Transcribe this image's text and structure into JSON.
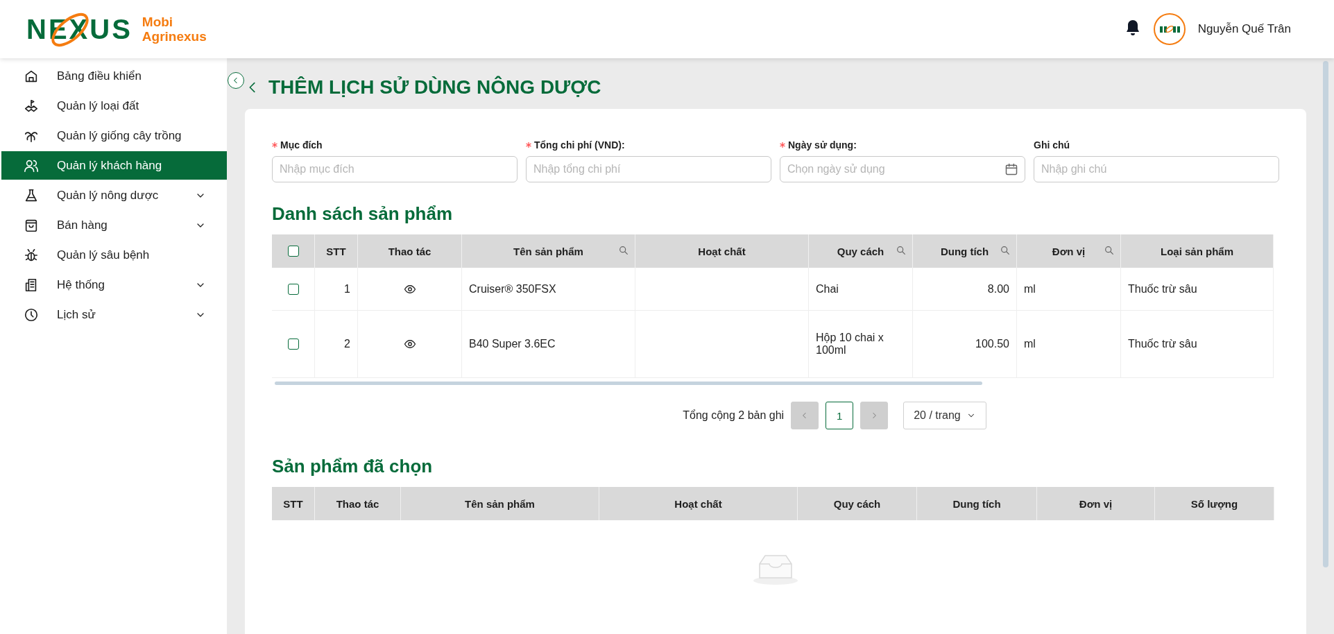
{
  "logo": {
    "wordmark": "NEXUS",
    "brand_line1": "Mobi",
    "brand_line2": "Agrinexus"
  },
  "user": {
    "name": "Nguyễn Quế Trân"
  },
  "sidebar": {
    "items": [
      {
        "label": "Bảng điều khiển",
        "selected": false,
        "has_submenu": false
      },
      {
        "label": "Quản lý loại đất",
        "selected": false,
        "has_submenu": false
      },
      {
        "label": "Quản lý giống cây trồng",
        "selected": false,
        "has_submenu": false
      },
      {
        "label": "Quản lý khách hàng",
        "selected": true,
        "has_submenu": false
      },
      {
        "label": "Quản lý nông dược",
        "selected": false,
        "has_submenu": true
      },
      {
        "label": "Bán hàng",
        "selected": false,
        "has_submenu": true
      },
      {
        "label": "Quản lý sâu bệnh",
        "selected": false,
        "has_submenu": false
      },
      {
        "label": "Hệ thống",
        "selected": false,
        "has_submenu": true
      },
      {
        "label": "Lịch sử",
        "selected": false,
        "has_submenu": true
      }
    ]
  },
  "page_title": "THÊM LỊCH SỬ DÙNG NÔNG DƯỢC",
  "form": {
    "fields": [
      {
        "label": "Mục đích",
        "required": true,
        "placeholder": "Nhập mục đích",
        "kind": "text"
      },
      {
        "label": "Tổng chi phí (VND):",
        "required": true,
        "placeholder": "Nhập tổng chi phí",
        "kind": "text"
      },
      {
        "label": "Ngày sử dụng:",
        "required": true,
        "placeholder": "Chọn ngày sử dụng",
        "kind": "date"
      },
      {
        "label": "Ghi chú",
        "required": false,
        "placeholder": "Nhập ghi chú",
        "kind": "text"
      }
    ]
  },
  "product_list": {
    "title": "Danh sách sản phẩm",
    "select_all": {
      "checked": false
    },
    "columns": [
      {
        "label": "STT",
        "searchable": false
      },
      {
        "label": "Thao tác",
        "searchable": false
      },
      {
        "label": "Tên sản phẩm",
        "searchable": true
      },
      {
        "label": "Hoạt chất",
        "searchable": false
      },
      {
        "label": "Quy cách",
        "searchable": true
      },
      {
        "label": "Dung tích",
        "searchable": true
      },
      {
        "label": "Đơn vị",
        "searchable": true
      },
      {
        "label": "Loại sản phẩm",
        "searchable": false
      }
    ],
    "rows": [
      {
        "checked": false,
        "stt": "1",
        "name": "Cruiser® 350FSX",
        "spec": "Chai",
        "volume": "8.00",
        "unit": "ml",
        "type": "Thuốc trừ sâu"
      },
      {
        "checked": false,
        "stt": "2",
        "name": "B40 Super 3.6EC",
        "spec": "Hộp 10 chai x 100ml",
        "volume": "100.50",
        "unit": "ml",
        "type": "Thuốc trừ sâu"
      }
    ],
    "pagination": {
      "total": "Tổng cộng 2 bản ghi",
      "prev_disabled": true,
      "next_disabled": true,
      "pages": [
        {
          "label": "1",
          "selected": true
        }
      ],
      "page_size": "20 / trang"
    }
  },
  "selected_products": {
    "title": "Sản phẩm đã chọn",
    "columns": [
      {
        "label": "STT"
      },
      {
        "label": "Thao tác"
      },
      {
        "label": "Tên sản phẩm"
      },
      {
        "label": "Hoạt chất"
      },
      {
        "label": "Quy cách"
      },
      {
        "label": "Dung tích"
      },
      {
        "label": "Đơn vị"
      },
      {
        "label": "Số lượng"
      }
    ]
  }
}
